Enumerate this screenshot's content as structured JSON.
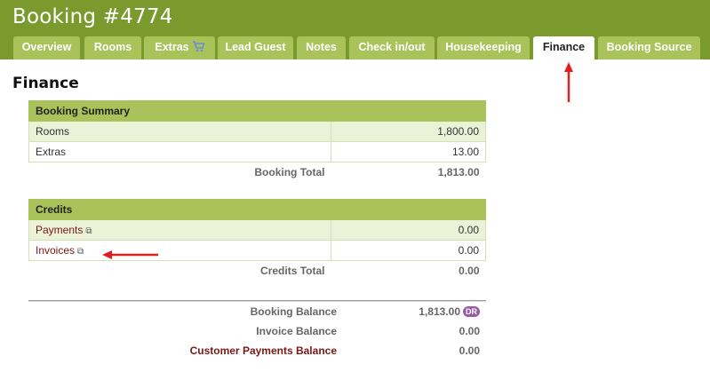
{
  "page": {
    "title": "Booking #4774",
    "section_title": "Finance"
  },
  "tabs": [
    {
      "label": "Overview"
    },
    {
      "label": "Rooms"
    },
    {
      "label": "Extras"
    },
    {
      "label": "Lead Guest"
    },
    {
      "label": "Notes"
    },
    {
      "label": "Check in/out"
    },
    {
      "label": "Housekeeping"
    },
    {
      "label": "Finance",
      "active": true
    },
    {
      "label": "Booking Source"
    }
  ],
  "booking_summary": {
    "title": "Booking Summary",
    "rows": [
      {
        "label": "Rooms",
        "value": "1,800.00"
      },
      {
        "label": "Extras",
        "value": "13.00"
      }
    ],
    "total_label": "Booking Total",
    "total_value": "1,813.00"
  },
  "credits": {
    "title": "Credits",
    "rows": [
      {
        "label": "Payments",
        "value": "0.00"
      },
      {
        "label": "Invoices",
        "value": "0.00"
      }
    ],
    "total_label": "Credits Total",
    "total_value": "0.00"
  },
  "balances": {
    "booking_balance_label": "Booking Balance",
    "booking_balance_value": "1,813.00",
    "booking_balance_badge": "DR",
    "invoice_balance_label": "Invoice Balance",
    "invoice_balance_value": "0.00",
    "customer_payments_label": "Customer Payments Balance",
    "customer_payments_value": "0.00"
  },
  "colors": {
    "header": "#7a9a2e",
    "tab": "#a9c25a",
    "table_header": "#a9c25a",
    "link": "#7b1616",
    "annotation_arrow": "#e02020",
    "badge": "#9a5aa4"
  },
  "icons": [
    "shopping-cart-icon",
    "external-link-icon",
    "annotation-arrow-up",
    "annotation-arrow-left"
  ]
}
